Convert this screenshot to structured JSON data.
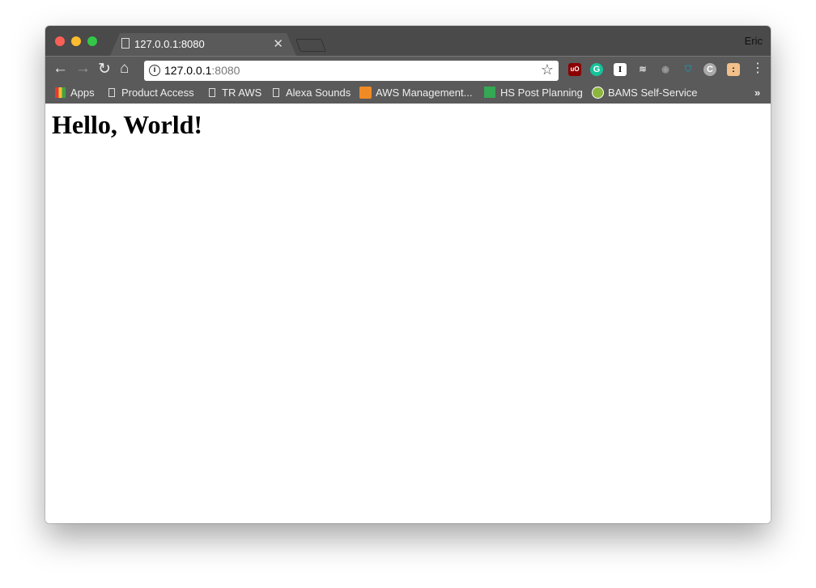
{
  "window": {
    "user": "Eric",
    "traffic_colors": [
      "#fc5f57",
      "#fdbc2e",
      "#33c748"
    ]
  },
  "tab": {
    "title": "127.0.0.1:8080"
  },
  "omnibox": {
    "host": "127.0.0.1",
    "port": ":8080"
  },
  "extensions": [
    "ublock-origin-icon",
    "grammarly-icon",
    "instapaper-icon",
    "stack-icon",
    "camera-icon",
    "shield-icon",
    "c-icon",
    "face-icon"
  ],
  "bookmarks": [
    {
      "label": "Apps"
    },
    {
      "label": "Product Access"
    },
    {
      "label": "TR AWS"
    },
    {
      "label": "Alexa Sounds"
    },
    {
      "label": "AWS Management..."
    },
    {
      "label": "HS Post Planning"
    },
    {
      "label": "BAMS Self-Service"
    }
  ],
  "page": {
    "heading": "Hello, World!"
  }
}
